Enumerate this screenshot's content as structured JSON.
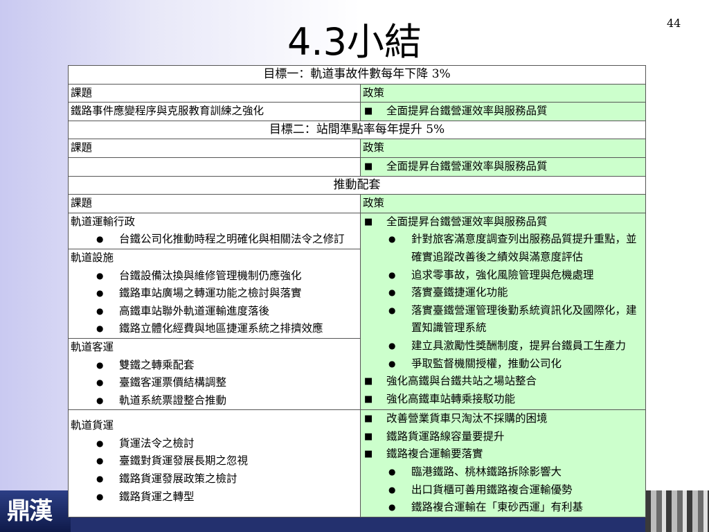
{
  "slide": {
    "page_number": "44",
    "title": "4.3小結"
  },
  "goals": [
    {
      "heading": "目標一：軌道事故件數每年下降 3%",
      "topic_label": "課題",
      "policy_label": "政策",
      "topic": "鐵路事件應變程序與克服教育訓練之強化",
      "policy": "全面提昇台鐵營運效率與服務品質"
    },
    {
      "heading": "目標二：站間準點率每年提升 5%",
      "topic_label": "課題",
      "policy_label": "政策",
      "topic": "",
      "policy": "全面提昇台鐵營運效率與服務品質"
    }
  ],
  "package": {
    "heading": "推動配套",
    "topic_label": "課題",
    "policy_label": "政策",
    "topics_upper": [
      {
        "category": "軌道運輸行政",
        "items": [
          "台鐵公司化推動時程之明確化與相關法令之修訂"
        ]
      },
      {
        "category": "軌道設施",
        "items": [
          "台鐵設備汰換與維修管理機制仍應強化",
          "鐵路車站廣場之轉運功能之檢討與落實",
          "高鐵車站聯外軌道運輸進度落後",
          "鐵路立體化經費與地區捷運系統之排擠效應"
        ]
      },
      {
        "category": "軌道客運",
        "items": [
          "雙鐵之轉乘配套",
          "臺鐵客運票價結構調整",
          "軌道系統票證整合推動"
        ]
      }
    ],
    "policies_upper": [
      {
        "text": "全面提昇台鐵營運效率與服務品質",
        "sub": [
          "針對旅客滿意度調查列出服務品質提升重點，並確實追蹤改善後之績效與滿意度評估",
          "追求零事故，強化風險管理與危機處理",
          "落實臺鐵捷運化功能",
          "落實臺鐵營運管理後勤系統資訊化及國際化，建置知識管理系統",
          "建立具激勵性獎酬制度，提昇台鐵員工生產力",
          "爭取監督機關授權，推動公司化"
        ]
      },
      {
        "text": "強化高鐵與台鐵共站之場站整合",
        "sub": []
      },
      {
        "text": "強化高鐵車站轉乘接駁功能",
        "sub": []
      }
    ],
    "topics_lower": [
      {
        "category": "軌道貨運",
        "items": [
          "貨運法令之檢討",
          "臺鐵對貨運發展長期之忽視",
          "鐵路貨運發展政策之檢討",
          "鐵路貨運之轉型"
        ]
      }
    ],
    "policies_lower": [
      {
        "text": "改善營業貨車只淘汰不採購的困境",
        "sub": []
      },
      {
        "text": "鐵路貨運路線容量要提升",
        "sub": []
      },
      {
        "text": "鐵路複合運輸要落實",
        "sub": [
          "臨港鐵路、桃林鐵路拆除影響大",
          "出口貨櫃可善用鐵路複合運輸優勢",
          "鐵路複合運輸在「東砂西運」有利基"
        ]
      }
    ]
  },
  "footer": {
    "logo_text": "鼎漢"
  },
  "colors": {
    "policy_bg": "#ccffcc",
    "footer_bar": "#23306e"
  }
}
